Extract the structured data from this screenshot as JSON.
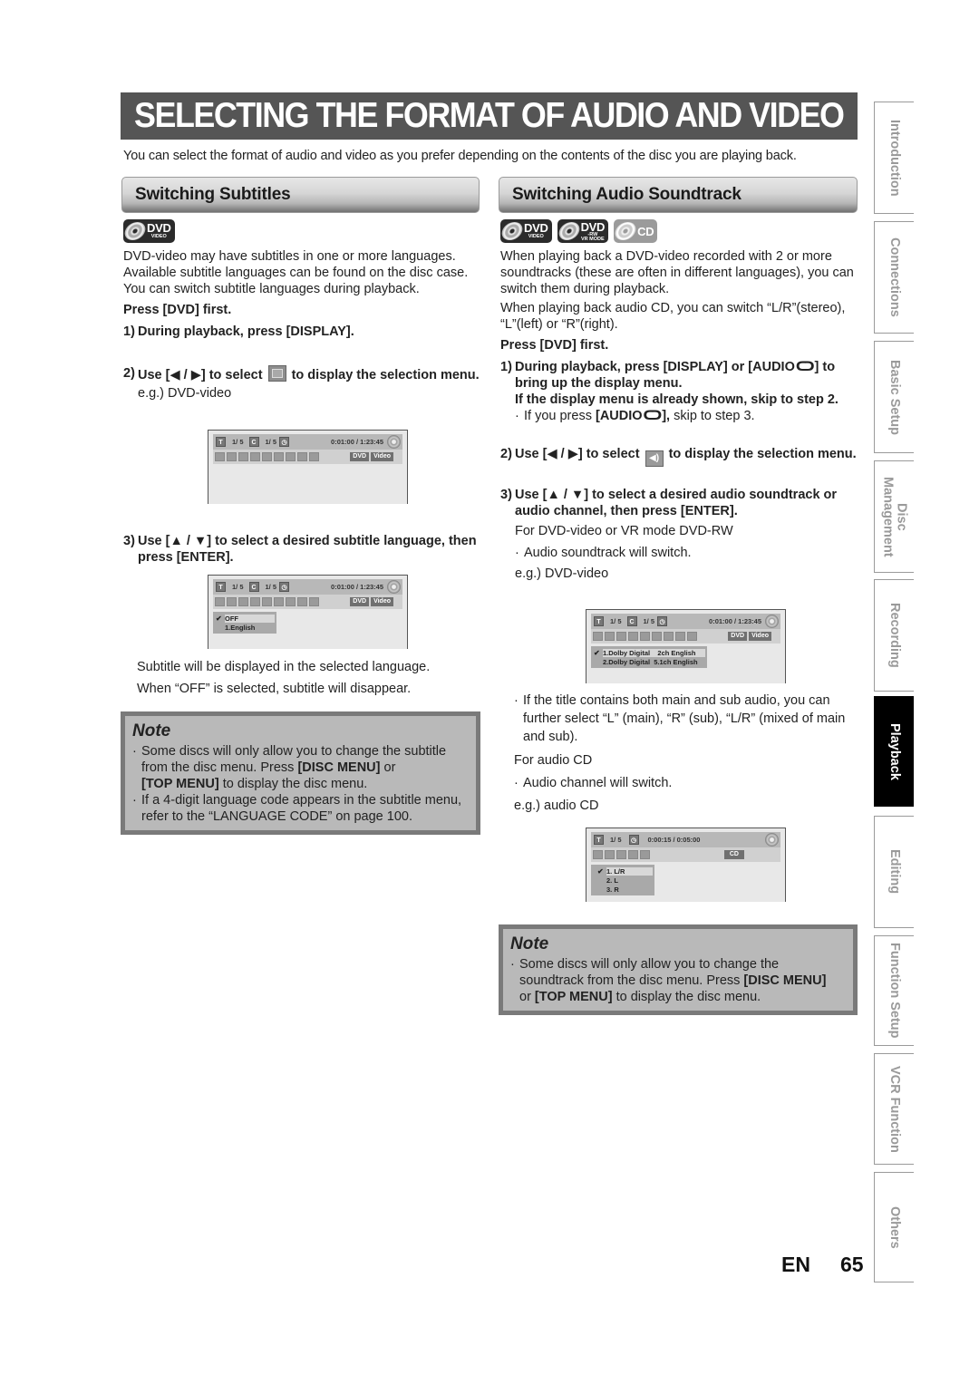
{
  "page": {
    "title": "SELECTING THE FORMAT OF AUDIO AND VIDEO",
    "intro": "You can select the format of audio and video as you prefer depending on the contents of the disc you are playing back.",
    "language": "EN",
    "page_number": "65"
  },
  "subtitles": {
    "heading": "Switching Subtitles",
    "disc_logos": [
      {
        "icon": "dvd-video-logo-icon",
        "big": "DVD",
        "small": "VIDEO"
      }
    ],
    "description": "DVD-video may have subtitles in one or more languages. Available subtitle languages can be found on the disc case. You can switch subtitle languages during playback.",
    "press_first": "Press [DVD] first.",
    "steps": [
      {
        "num": "1)",
        "text": "During playback, press [DISPLAY]."
      },
      {
        "num": "2)",
        "text_before": "Use [◀ / ▶] to select",
        "icon": "subtitle-icon",
        "text_after": "to display the selection menu.",
        "example": "e.g.) DVD-video"
      },
      {
        "num": "3)",
        "text": "Use [▲ / ▼] to select a desired subtitle language, then press [ENTER]."
      }
    ],
    "result_lines": [
      "Subtitle will be displayed in the selected language.",
      "When “OFF” is selected, subtitle will disappear."
    ],
    "osd_1": {
      "title_label": "T",
      "title_value": "1/  5",
      "chapter_label": "C",
      "chapter_value": "1/  5",
      "time": "0:01:00 / 1:23:45",
      "tags": [
        "DVD",
        "Video"
      ],
      "menu": []
    },
    "osd_2": {
      "title_label": "T",
      "title_value": "1/  5",
      "chapter_label": "C",
      "chapter_value": "1/  5",
      "time": "0:01:00 / 1:23:45",
      "tags": [
        "DVD",
        "Video"
      ],
      "menu": [
        {
          "label": "OFF",
          "selected": true
        },
        {
          "label": "1.English",
          "selected": false
        }
      ]
    },
    "note": {
      "heading": "Note",
      "items": [
        {
          "parts": [
            "Some discs will only allow you to change the subtitle from the disc menu. Press ",
            "[DISC MENU]",
            " or ",
            "[TOP MENU]",
            " to display the disc menu."
          ]
        },
        {
          "parts": [
            "If a 4-digit language code appears in the subtitle menu, refer to the “LANGUAGE CODE” on page 100."
          ]
        }
      ]
    }
  },
  "audio": {
    "heading": "Switching Audio Soundtrack",
    "disc_logos": [
      {
        "icon": "dvd-video-logo-icon",
        "big": "DVD",
        "small": "VIDEO"
      },
      {
        "icon": "dvd-rw-vr-logo-icon",
        "big": "DVD",
        "small": "-RW",
        "small2": "VR MODE"
      },
      {
        "icon": "cd-logo-icon",
        "big": "CD"
      }
    ],
    "description_1": "When playing back a DVD-video recorded with 2 or more soundtracks (these are often in different languages), you can switch them during playback.",
    "description_2": "When playing back audio CD, you can switch “L/R”(stereo), “L”(left) or “R”(right).",
    "press_first": "Press [DVD] first.",
    "step1": {
      "num": "1)",
      "line1_before": "During playback, press [DISPLAY] or [AUDIO",
      "line1_after": "] to bring up the display menu.",
      "line2": "If the display menu is already shown, skip to step 2.",
      "bullet_before": "If you press ",
      "bullet_bold": "[AUDIO",
      "bullet_bold_after": "],",
      "bullet_after": " skip to step 3."
    },
    "step2": {
      "num": "2)",
      "text_before": "Use [◀ / ▶] to select",
      "icon": "audio-speaker-icon",
      "text_after": "to display the selection menu."
    },
    "step3": {
      "num": "3)",
      "text": "Use [▲ / ▼] to select a desired audio soundtrack or audio channel, then press [ENTER]."
    },
    "dvd_label": "For DVD-video or VR mode DVD-RW",
    "dvd_bullet": "Audio soundtrack will switch.",
    "dvd_example": "e.g.) DVD-video",
    "osd_dvd": {
      "title_label": "T",
      "title_value": "1/  5",
      "chapter_label": "C",
      "chapter_value": "1/  5",
      "time": "0:01:00 / 1:23:45",
      "tags": [
        "DVD",
        "Video"
      ],
      "menu": [
        {
          "label": "1.Dolby Digital    2ch English",
          "selected": true
        },
        {
          "label": "2.Dolby Digital  5.1ch English",
          "selected": false
        }
      ]
    },
    "main_sub_bullet": "If the title contains both main and sub audio, you can further select “L” (main), “R” (sub), “L/R” (mixed of main and sub).",
    "cd_label": "For audio CD",
    "cd_bullet": "Audio channel will switch.",
    "cd_example": "e.g.) audio CD",
    "osd_cd": {
      "title_label": "T",
      "title_value": "1/  5",
      "time": "0:00:15 / 0:05:00",
      "tags": [
        "CD"
      ],
      "menu": [
        {
          "label": "1. L/R",
          "selected": true
        },
        {
          "label": "2. L",
          "selected": false
        },
        {
          "label": "3. R",
          "selected": false
        }
      ]
    },
    "note": {
      "heading": "Note",
      "items": [
        {
          "parts": [
            "Some discs will only allow you to change the soundtrack from the disc menu. Press ",
            "[DISC MENU]",
            " or ",
            "[TOP MENU]",
            " to display the disc menu."
          ]
        }
      ]
    }
  },
  "side_tabs": [
    {
      "label": "Introduction",
      "active": false
    },
    {
      "label": "Connections",
      "active": false
    },
    {
      "label": "Basic Setup",
      "active": false
    },
    {
      "label": "Disc\nManagement",
      "active": false
    },
    {
      "label": "Recording",
      "active": false
    },
    {
      "label": "Playback",
      "active": true
    },
    {
      "label": "Editing",
      "active": false
    },
    {
      "label": "Function Setup",
      "active": false
    },
    {
      "label": "VCR Function",
      "active": false
    },
    {
      "label": "Others",
      "active": false
    }
  ]
}
